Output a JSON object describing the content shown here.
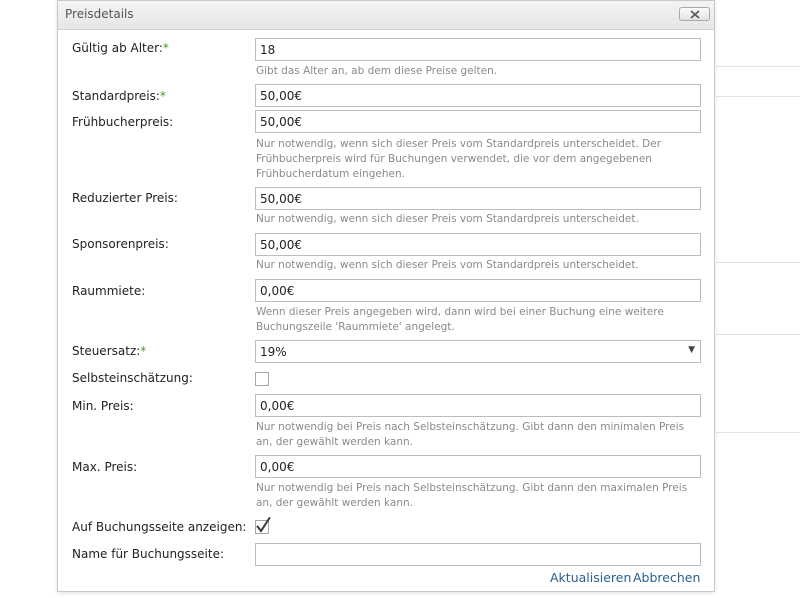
{
  "dialog": {
    "title": "Preisdetails"
  },
  "required_marker": "*",
  "fields": {
    "age": {
      "label": "Gültig ab Alter:",
      "value": "18",
      "hint": "Gibt das Alter an, ab dem diese Preise gelten."
    },
    "standard": {
      "label": "Standardpreis:",
      "value": "50,00€"
    },
    "early": {
      "label": "Frühbucherpreis:",
      "value": "50,00€",
      "hint": "Nur notwendig, wenn sich dieser Preis vom Standardpreis unterscheidet. Der Frühbucherpreis wird für Buchungen verwendet, die vor dem angegebenen Frühbucherdatum eingehen."
    },
    "reduced": {
      "label": "Reduzierter Preis:",
      "value": "50,00€",
      "hint": "Nur notwendig, wenn sich dieser Preis vom Standardpreis unterscheidet."
    },
    "sponsor": {
      "label": "Sponsorenpreis:",
      "value": "50,00€",
      "hint": "Nur notwendig, wenn sich dieser Preis vom Standardpreis unterscheidet."
    },
    "room": {
      "label": "Raummiete:",
      "value": "0,00€",
      "hint": "Wenn dieser Preis angegeben wird, dann wird bei einer Buchung eine weitere Buchungszeile 'Raummiete' angelegt."
    },
    "tax": {
      "label": "Steuersatz:",
      "value": "19%"
    },
    "self_assessment": {
      "label": "Selbsteinschätzung:",
      "checked": false
    },
    "min_price": {
      "label": "Min. Preis:",
      "value": "0,00€",
      "hint": "Nur notwendig bei Preis nach Selbsteinschätzung. Gibt dann den minimalen Preis an, der gewählt werden kann."
    },
    "max_price": {
      "label": "Max. Preis:",
      "value": "0,00€",
      "hint": "Nur notwendig bei Preis nach Selbsteinschätzung. Gibt dann den maximalen Preis an, der gewählt werden kann."
    },
    "show_on_booking": {
      "label": "Auf Buchungsseite anzeigen:",
      "checked": true
    },
    "booking_name": {
      "label": "Name für Buchungsseite:",
      "value": ""
    }
  },
  "actions": {
    "update": "Aktualisieren",
    "cancel": "Abbrechen"
  },
  "colors": {
    "required": "#4a9a2e",
    "link": "#2a5f8f",
    "hint": "#8a8a8a"
  },
  "icons": {
    "close": "close-icon",
    "dropdown": "chevron-down-icon",
    "check": "checkmark-icon"
  }
}
